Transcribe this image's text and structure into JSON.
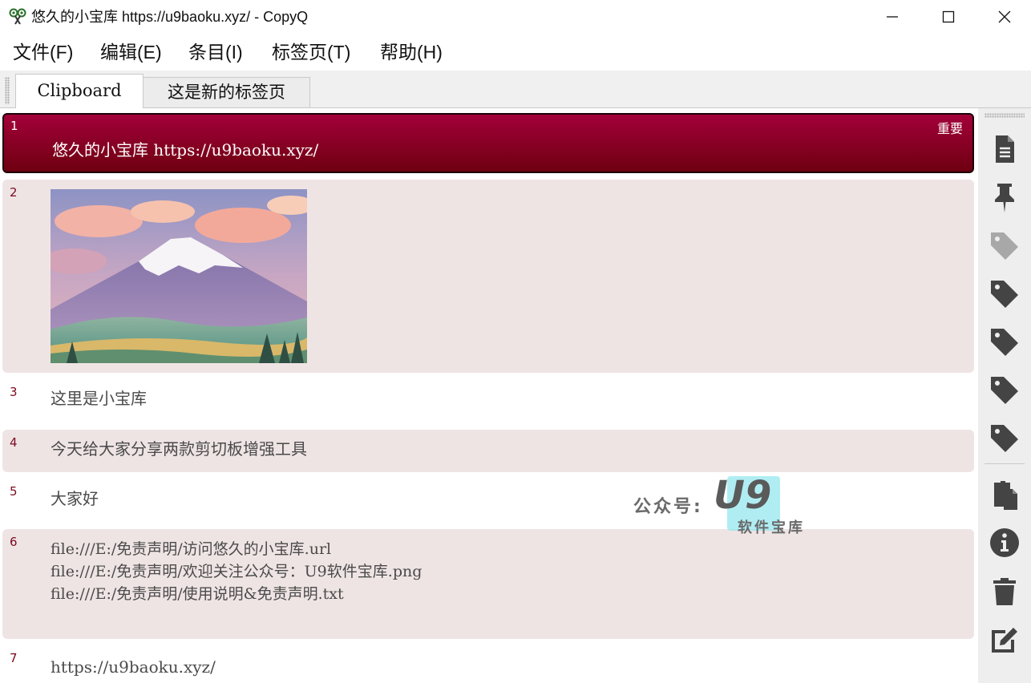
{
  "window": {
    "title": "悠久的小宝库 https://u9baoku.xyz/ - CopyQ",
    "app_icon": "copyq-scissors-icon",
    "controls": [
      "minimize-icon",
      "maximize-icon",
      "close-icon"
    ]
  },
  "menu": [
    {
      "label": "文件(F)"
    },
    {
      "label": "编辑(E)"
    },
    {
      "label": "条目(I)"
    },
    {
      "label": "标签页(T)"
    },
    {
      "label": "帮助(H)"
    }
  ],
  "tabs": [
    {
      "label": "Clipboard",
      "active": true
    },
    {
      "label": "这是新的标签页",
      "active": false
    }
  ],
  "items": [
    {
      "num": "1",
      "text": "悠久的小宝库 https://u9baoku.xyz/",
      "tag": "重要",
      "selected": true
    },
    {
      "num": "2",
      "type": "image",
      "image_alt": "mountain-landscape-image"
    },
    {
      "num": "3",
      "text": "这里是小宝库"
    },
    {
      "num": "4",
      "text": "今天给大家分享两款剪切板增强工具"
    },
    {
      "num": "5",
      "text": "大家好"
    },
    {
      "num": "6",
      "lines": [
        "file:///E:/免责声明/访问悠久的小宝库.url",
        "file:///E:/免责声明/欢迎关注公众号：U9软件宝库.png",
        "file:///E:/免责声明/使用说明&免责声明.txt"
      ]
    },
    {
      "num": "7",
      "text": "https://u9baoku.xyz/"
    }
  ],
  "watermark": {
    "prefix": "公众号:",
    "logo": "U9",
    "subtitle": "软件宝库"
  },
  "sidebar": [
    "new-item-icon",
    "pin-icon",
    "tag-icon-disabled",
    "tag-icon",
    "tag-icon",
    "tag-icon",
    "tag-icon",
    "paste-icon",
    "info-icon",
    "delete-icon",
    "edit-icon"
  ],
  "colors": {
    "selected_top": "#a3003a",
    "selected_bottom": "#6e0010",
    "alt_row": "#efe4e4",
    "row_number": "#7a0a1e",
    "icon": "#444444"
  }
}
